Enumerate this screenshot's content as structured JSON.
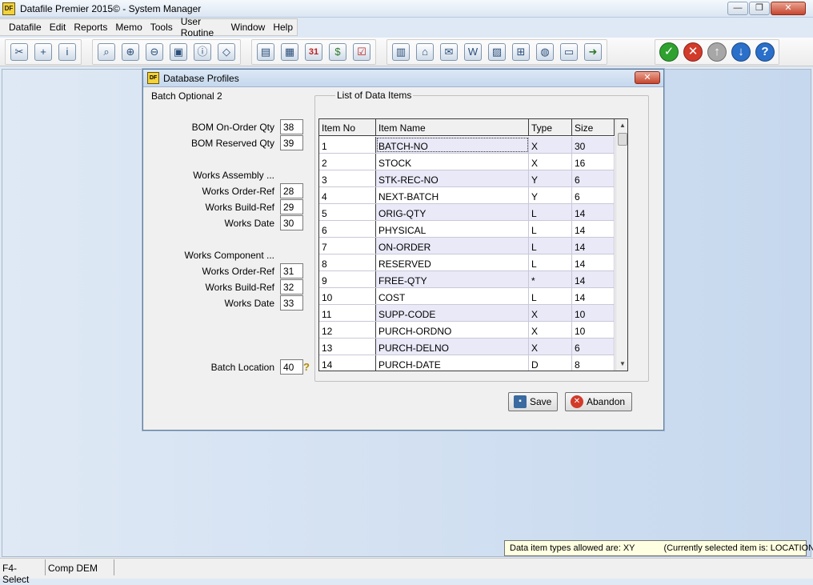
{
  "window": {
    "title": "Datafile  Premier 2015© - System Manager",
    "app_icon_text": "DF",
    "minimize": "—",
    "maximize": "❐",
    "close": "✕"
  },
  "menu": [
    "Datafile",
    "Edit",
    "Reports",
    "Memo",
    "Tools",
    "User Routine",
    "Window",
    "Help"
  ],
  "dialog": {
    "title": "Database Profiles",
    "close": "✕",
    "section_title": "Batch Optional 2",
    "fields": [
      {
        "label": "BOM On-Order Qty",
        "value": "38"
      },
      {
        "label": "BOM Reserved Qty",
        "value": "39"
      },
      {
        "label": "Works Assembly ...",
        "value": null
      },
      {
        "label": "Works Order-Ref",
        "value": "28"
      },
      {
        "label": "Works Build-Ref",
        "value": "29"
      },
      {
        "label": "Works Date",
        "value": "30"
      },
      {
        "label": "Works Component ...",
        "value": null
      },
      {
        "label": "Works Order-Ref",
        "value": "31"
      },
      {
        "label": "Works Build-Ref",
        "value": "32"
      },
      {
        "label": "Works Date",
        "value": "33"
      },
      {
        "label": "Batch Location",
        "value": "40"
      }
    ],
    "group_title": "List of Data Items",
    "table": {
      "headers": [
        "Item No",
        "Item Name",
        "Type",
        "Size"
      ],
      "rows": [
        [
          "1",
          "BATCH-NO",
          "X",
          "30"
        ],
        [
          "2",
          "STOCK",
          "X",
          "16"
        ],
        [
          "3",
          "STK-REC-NO",
          "Y",
          "6"
        ],
        [
          "4",
          "NEXT-BATCH",
          "Y",
          "6"
        ],
        [
          "5",
          "ORIG-QTY",
          "L",
          "14"
        ],
        [
          "6",
          "PHYSICAL",
          "L",
          "14"
        ],
        [
          "7",
          "ON-ORDER",
          "L",
          "14"
        ],
        [
          "8",
          "RESERVED",
          "L",
          "14"
        ],
        [
          "9",
          "FREE-QTY",
          "*",
          "14"
        ],
        [
          "10",
          "COST",
          "L",
          "14"
        ],
        [
          "11",
          "SUPP-CODE",
          "X",
          "10"
        ],
        [
          "12",
          "PURCH-ORDNO",
          "X",
          "10"
        ],
        [
          "13",
          "PURCH-DELNO",
          "X",
          "6"
        ],
        [
          "14",
          "PURCH-DATE",
          "D",
          "8"
        ]
      ]
    },
    "save_label": "Save",
    "abandon_label": "Abandon"
  },
  "hint": {
    "allowed": "Data item types allowed are: XY",
    "selected": "(Currently selected item is: LOCATION)"
  },
  "status": [
    "F4-Select",
    "Comp DEM"
  ]
}
